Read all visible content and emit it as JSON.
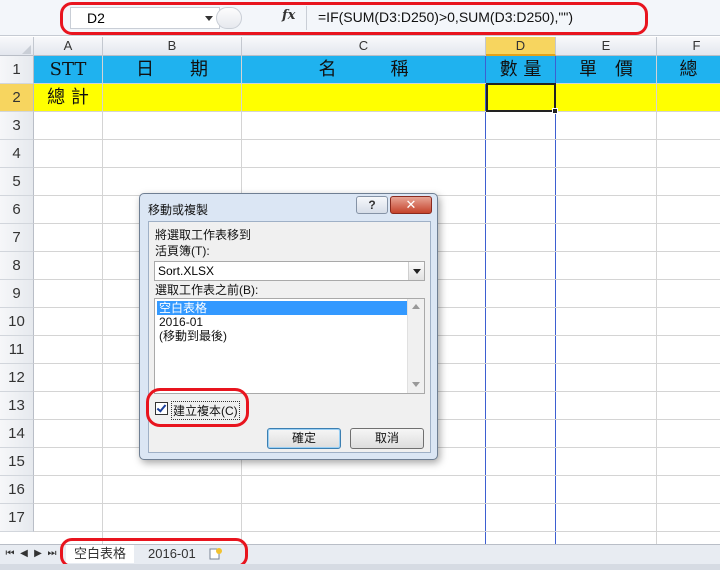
{
  "formula_bar": {
    "name_box": "D2",
    "fx_label": "fx",
    "formula": "=IF(SUM(D3:D250)>0,SUM(D3:D250),\"\")"
  },
  "columns": [
    "A",
    "B",
    "C",
    "D",
    "E",
    "F"
  ],
  "selected_column": "D",
  "rows": [
    "1",
    "2",
    "3",
    "4",
    "5",
    "6",
    "7",
    "8",
    "9",
    "10",
    "11",
    "12",
    "13",
    "14",
    "15",
    "16",
    "17"
  ],
  "selected_row": "2",
  "sheet_cells": {
    "a1": "STT",
    "b1": "日　　期",
    "c1": "名　　　稱",
    "d1": "數 量",
    "e1": "單　價",
    "f1": "總　",
    "a2": "總 計"
  },
  "dialog": {
    "title": "移動或複製",
    "help_label": "?",
    "close_label": "✕",
    "move_label": "將選取工作表移到",
    "workbook_label": "活頁簿(T):",
    "workbook_value": "Sort.XLSX",
    "before_label": "選取工作表之前(B):",
    "sheet_list": [
      "空白表格",
      "2016-01",
      "(移動到最後)"
    ],
    "create_copy_label": "建立複本(C)",
    "create_copy_checked": true,
    "ok_label": "確定",
    "cancel_label": "取消"
  },
  "tabs": {
    "nav": [
      "⏮",
      "◀",
      "▶",
      "⏭"
    ],
    "sheets": [
      "空白表格",
      "2016-01"
    ],
    "active": "空白表格"
  },
  "colors": {
    "header_row": "#1fb2ef",
    "total_row": "#ffff00",
    "highlight_ring": "#e8141e"
  }
}
